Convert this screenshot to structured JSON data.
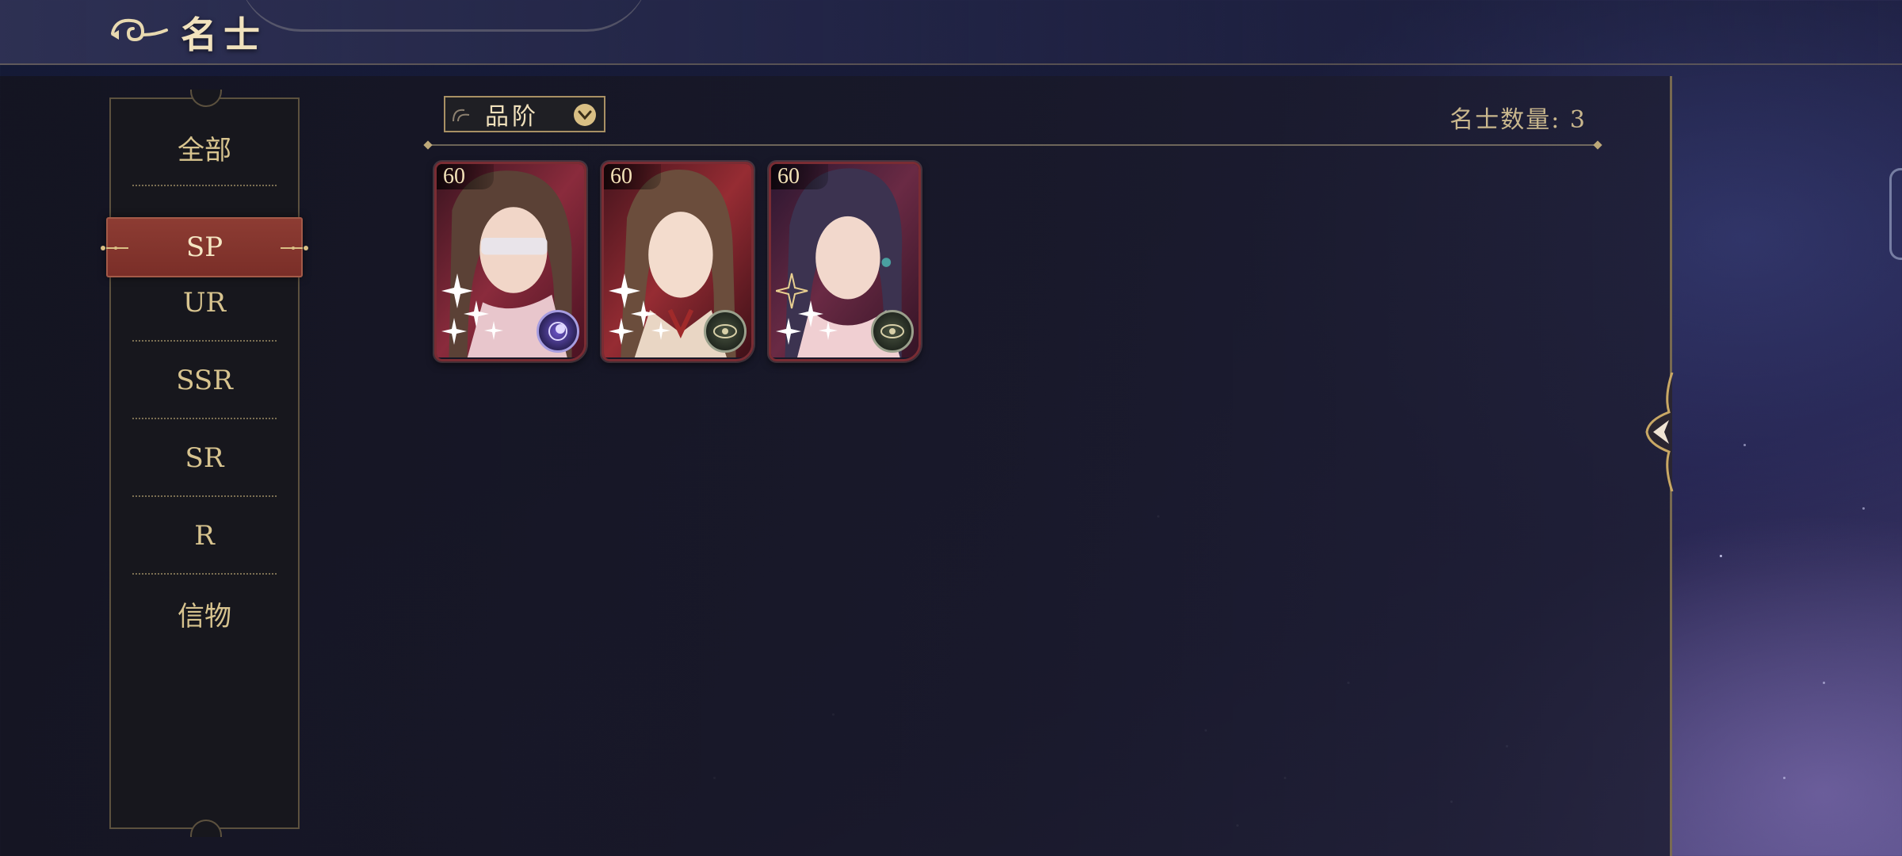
{
  "header": {
    "title": "名士"
  },
  "sidebar": {
    "items": [
      {
        "label": "全部",
        "active": false
      },
      {
        "label": "SP",
        "active": true
      },
      {
        "label": "UR",
        "active": false
      },
      {
        "label": "SSR",
        "active": false
      },
      {
        "label": "SR",
        "active": false
      },
      {
        "label": "R",
        "active": false
      },
      {
        "label": "信物",
        "active": false
      }
    ]
  },
  "filter": {
    "label": "品阶"
  },
  "count": {
    "text": "名士数量: 3"
  },
  "cards": [
    {
      "level": "60",
      "badge_icon": "moon-orb-icon",
      "badge_color": "#5c47b8"
    },
    {
      "level": "60",
      "badge_icon": "eye-sigil-icon",
      "badge_color": "#3b4336"
    },
    {
      "level": "60",
      "badge_icon": "eye-sigil-icon",
      "badge_color": "#3b4336"
    }
  ],
  "colors": {
    "accent_gold": "#d9bf84",
    "active_tab": "#8d3c33",
    "card_border": "#7a2c33"
  }
}
